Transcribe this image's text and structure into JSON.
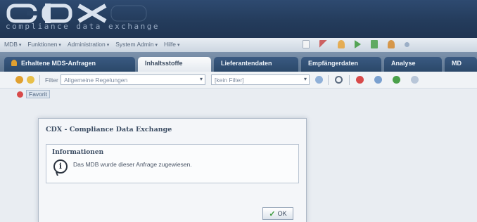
{
  "header": {
    "logo_text": "CDX",
    "tagline": "compliance data exchange"
  },
  "menubar": {
    "items": [
      "MDB",
      "Funktionen",
      "Administration",
      "System Admin",
      "Hilfe"
    ]
  },
  "tabs": [
    {
      "label": "Erhaltene MDS-Anfragen",
      "icon": "person-icon",
      "active": false
    },
    {
      "label": "Inhaltsstoffe",
      "active": true
    },
    {
      "label": "Lieferantendaten",
      "active": false
    },
    {
      "label": "Empfängerdaten",
      "active": false
    },
    {
      "label": "Analyse",
      "active": false
    },
    {
      "label": "MD",
      "active": false
    }
  ],
  "toolbar": {
    "filter_label": "Filter",
    "filter_select": "Allgemeine Regelungen",
    "second_select": "[kein Filter]"
  },
  "favorites": {
    "label": "Favorit"
  },
  "dialog": {
    "title": "CDX - Compliance Data Exchange",
    "info_title": "Informationen",
    "message": "Das MDB wurde dieser Anfrage zugewiesen.",
    "ok_label": "OK"
  },
  "colors": {
    "header": "#243c5c",
    "tab_inactive": "#2b4869",
    "accent_green": "#3d9a3d",
    "background": "#e9edf2"
  }
}
